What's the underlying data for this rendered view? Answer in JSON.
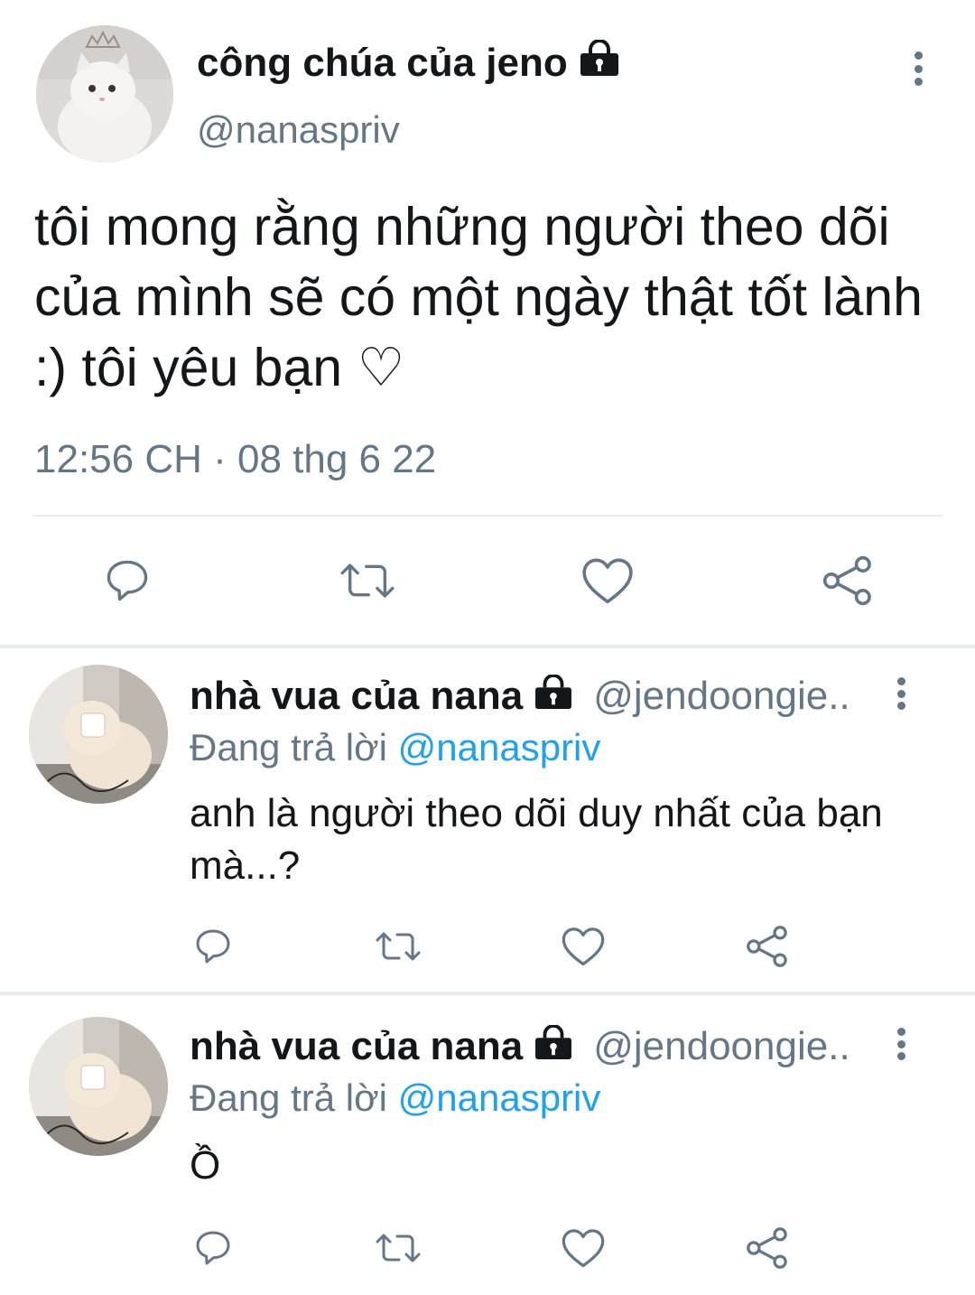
{
  "main_tweet": {
    "display_name": "công chúa của jeno",
    "handle": "@nanaspriv",
    "text": "tôi mong rằng những người theo dõi của mình sẽ có một ngày thật tốt lành :) tôi yêu bạn ♡",
    "timestamp": "12:56 CH · 08 thg 6 22"
  },
  "replies": [
    {
      "display_name": "nhà vua của nana",
      "handle": "@jendoongie..",
      "replying_prefix": "Đang trả lời",
      "replying_to": "@nanaspriv",
      "text": "anh là người theo dõi duy nhất của bạn mà...?"
    },
    {
      "display_name": "nhà vua của nana",
      "handle": "@jendoongie..",
      "replying_prefix": "Đang trả lời",
      "replying_to": "@nanaspriv",
      "text": "Ồ"
    }
  ],
  "icons": {
    "reply": "reply-icon",
    "retweet": "retweet-icon",
    "like": "heart-icon",
    "share": "share-icon",
    "lock": "lock-icon",
    "more": "more-vertical-icon"
  },
  "colors": {
    "secondary_text": "#657786",
    "mention": "#1da1f2",
    "icon": "#657786",
    "divider": "#e6ecf0"
  }
}
